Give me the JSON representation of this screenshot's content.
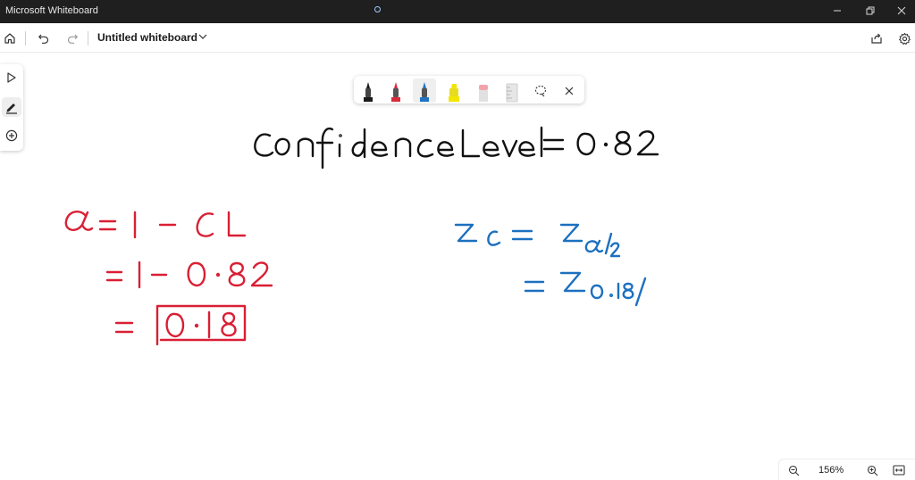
{
  "window": {
    "title": "Microsoft Whiteboard",
    "controls": [
      "minimize-icon",
      "restore-icon",
      "close-icon"
    ]
  },
  "toolbar": {
    "board_title": "Untitled whiteboard",
    "icons": [
      "home-icon",
      "undo-icon",
      "redo-icon",
      "share-icon",
      "gear-icon"
    ]
  },
  "left_rail": {
    "tools": [
      "select-pointer-icon",
      "pen-inking-icon",
      "add-icon"
    ],
    "active": "pen-inking-icon"
  },
  "ink_toolbar": {
    "tools": [
      {
        "name": "pen-black",
        "color": "#1a1a1a"
      },
      {
        "name": "pen-red",
        "color": "#d92b3a"
      },
      {
        "name": "pen-blue",
        "color": "#1e74c2"
      },
      {
        "name": "highlighter-yellow",
        "color": "#f2e600"
      },
      {
        "name": "eraser",
        "color": "#f2a4ad"
      },
      {
        "name": "ruler",
        "color": "#d6d6d6"
      },
      {
        "name": "lasso-select",
        "color": "#333333"
      }
    ],
    "selected": "pen-blue",
    "close_icon": "close-icon"
  },
  "ink": {
    "black_color": "#111111",
    "red_color": "#d91f34",
    "blue_color": "#1c70bf",
    "heading": "Confidence Level = 0.82",
    "red_lines": [
      "α = 1 − CL",
      "= 1 − 0.82",
      "= 0.18"
    ],
    "blue_lines": [
      "z_c = z_{α/2}",
      "= z_{0.18/"
    ]
  },
  "zoom": {
    "level": "156%",
    "icons": [
      "zoom-out-icon",
      "zoom-in-icon",
      "fit-to-screen-icon"
    ]
  }
}
